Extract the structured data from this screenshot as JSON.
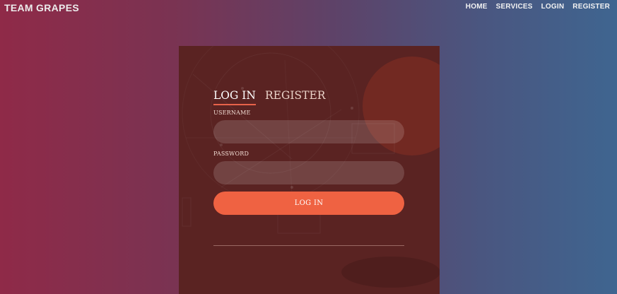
{
  "brand": "TEAM GRAPES",
  "nav": {
    "home": "HOME",
    "services": "SERVICES",
    "login": "LOGIN",
    "register": "REGISTER"
  },
  "form": {
    "tabs": {
      "login": "LOG IN",
      "register": "REGISTER"
    },
    "username_label": "USERNAME",
    "username_value": "",
    "password_label": "PASSWORD",
    "password_value": "",
    "submit_label": "LOG IN"
  },
  "colors": {
    "accent": "#ef6242",
    "card": "#5a2322",
    "gradient_left": "#8f2a48",
    "gradient_right": "#3f6590"
  }
}
